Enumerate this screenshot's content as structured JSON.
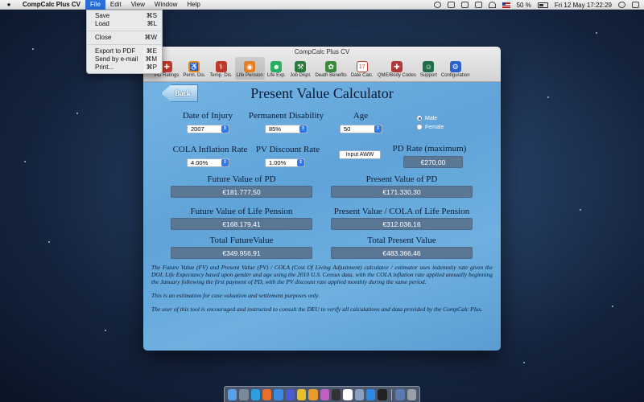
{
  "menubar": {
    "app_name": "CompCalc Plus CV",
    "menus": [
      "File",
      "Edit",
      "View",
      "Window",
      "Help"
    ],
    "battery": "50 %",
    "clock": "Fri 12 May  17:22:29"
  },
  "file_menu": {
    "items": [
      {
        "label": "Save",
        "shortcut": "⌘S"
      },
      {
        "label": "Load",
        "shortcut": "⌘L"
      },
      {
        "label": "Close",
        "shortcut": "⌘W"
      },
      {
        "label": "Export to PDF",
        "shortcut": "⌘E"
      },
      {
        "label": "Send by e-mail",
        "shortcut": "⌘M"
      },
      {
        "label": "Print...",
        "shortcut": "⌘P"
      }
    ]
  },
  "window": {
    "title": "CompCalc Plus CV",
    "toolbar": [
      {
        "label": "PD Ratings",
        "icon": "pd-ratings-icon",
        "color": "#c0392b"
      },
      {
        "label": "Perm. Dis.",
        "icon": "wheelchair-icon",
        "color": "#e08a1e"
      },
      {
        "label": "Temp. Dis.",
        "icon": "crutch-icon",
        "color": "#c0392b"
      },
      {
        "label": "Life Pension",
        "icon": "life-pension-icon",
        "color": "#e67e22"
      },
      {
        "label": "Life Exp.",
        "icon": "people-icon",
        "color": "#27ae60"
      },
      {
        "label": "Job Displ.",
        "icon": "worker-icon",
        "color": "#2c7a3e"
      },
      {
        "label": "Death Benefits",
        "icon": "death-benefits-icon",
        "color": "#3b8a3b"
      },
      {
        "label": "Date Calc.",
        "icon": "calendar-icon",
        "color": "#c0392b"
      },
      {
        "label": "QME/Body Codes",
        "icon": "medical-kit-icon",
        "color": "#b03a3a"
      },
      {
        "label": "Support",
        "icon": "support-person-icon",
        "color": "#1f6f4a"
      },
      {
        "label": "Configuration",
        "icon": "configuration-icon",
        "color": "#2a62c9"
      }
    ]
  },
  "calc": {
    "back_label": "Back",
    "title": "Present Value Calculator",
    "date_of_injury_label": "Date of Injury",
    "date_of_injury": "2007",
    "perm_disability_label": "Permanent Disability",
    "perm_disability": "85%",
    "age_label": "Age",
    "age": "50",
    "gender_male": "Male",
    "gender_female": "Female",
    "cola_label": "COLA Inflation Rate",
    "cola": "4.00%",
    "discount_label": "PV Discount Rate",
    "discount": "1.00%",
    "input_aww": "Input AWW",
    "pd_rate_label": "PD Rate (maximum)",
    "pd_rate": "€270,00",
    "fv_pd_label": "Future Value of PD",
    "fv_pd": "€181.777,50",
    "pv_pd_label": "Present Value of PD",
    "pv_pd": "€171.330,30",
    "fv_lp_label": "Future Value of Life Pension",
    "fv_lp": "€168.179,41",
    "pv_lp_label": "Present Value / COLA of Life Pension",
    "pv_lp": "€312.036,16",
    "total_fv_label": "Total FutureValue",
    "total_fv": "€349.956,91",
    "total_pv_label": "Total Present Value",
    "total_pv": "€483.366,46",
    "desc1": "The Future Value (FV) and Present Value (PV) / COLA (Cost Of Living Adjustment) calculator / estimator uses indemnity rate given the DOI, Life Expectancy based upon gender and age using the 2010 U.S. Census data, with the COLA inflation rate applied annually beginning the January following the first payment of PD, with the PV discount rate applied monthly during the same period.",
    "desc2": "This is an estimation for case valuation and settlement purposes only.",
    "desc3": "The user of this tool is encouraged and instructed to consult the DEU to verify all calculations and data provided by the CompCalc Plus."
  },
  "dock": [
    "finder-icon",
    "launchpad-icon",
    "skype-icon",
    "firefox-icon",
    "safari-icon",
    "vpn-icon",
    "notes-icon",
    "books-icon",
    "photos-icon",
    "terminal-box-icon",
    "calendar-icon",
    "preview-icon",
    "app-store-icon",
    "terminal-icon",
    "downloads-icon",
    "trash-icon"
  ]
}
